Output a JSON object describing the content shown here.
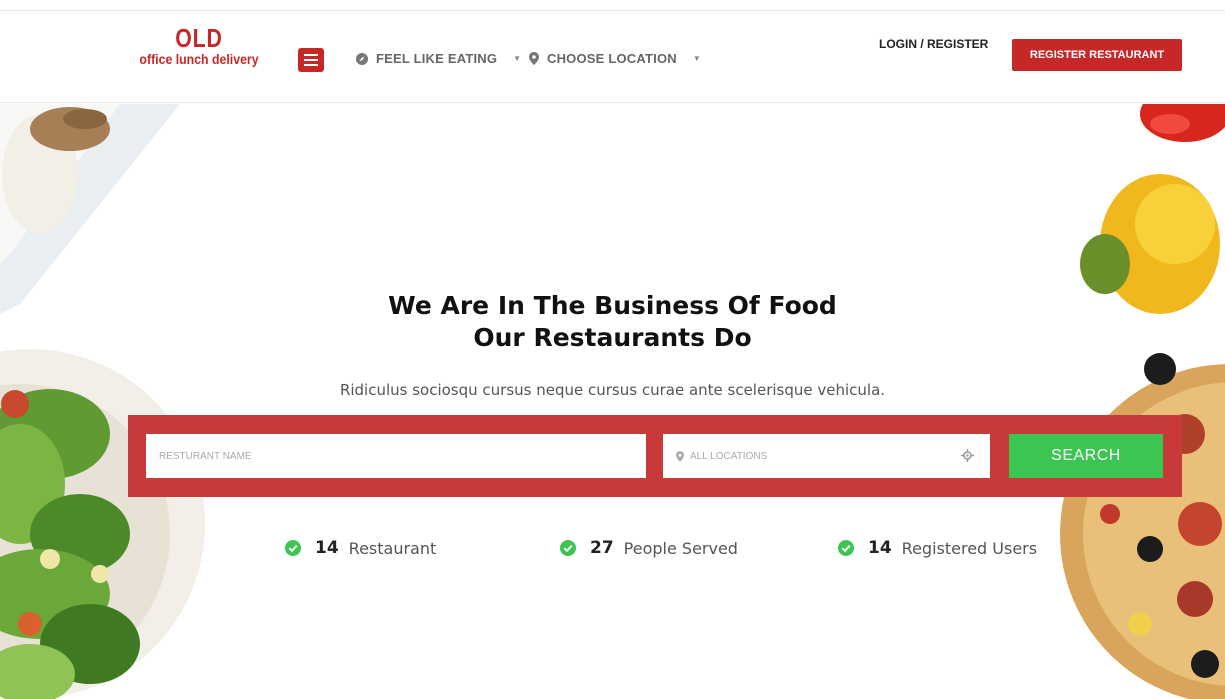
{
  "logo": {
    "big": "OLD",
    "small": "office lunch delivery"
  },
  "nav": {
    "feel_like_eating": "FEEL LIKE EATING",
    "choose_location": "CHOOSE LOCATION"
  },
  "auth": {
    "login": "LOGIN / REGISTER",
    "register_restaurant": "REGISTER RESTAURANT"
  },
  "hero": {
    "title_line1": "We Are In The Business Of Food",
    "title_line2": "Our Restaurants Do",
    "subtitle": "Ridiculus sociosqu cursus neque cursus curae ante scelerisque vehicula."
  },
  "search": {
    "name_placeholder": "RESTURANT NAME",
    "location_placeholder": "ALL LOCATIONS",
    "button": "SEARCH"
  },
  "stats": [
    {
      "value": "14",
      "label": "Restaurant"
    },
    {
      "value": "27",
      "label": "People Served"
    },
    {
      "value": "14",
      "label": "Registered Users"
    }
  ],
  "colors": {
    "brand_red": "#c62828",
    "search_bar": "#c8393a",
    "search_green": "#3cc552",
    "check_green": "#3cc552"
  },
  "icons": [
    "menu-icon",
    "compass-icon",
    "map-pin-icon",
    "crosshair-icon",
    "check-circle-icon"
  ]
}
